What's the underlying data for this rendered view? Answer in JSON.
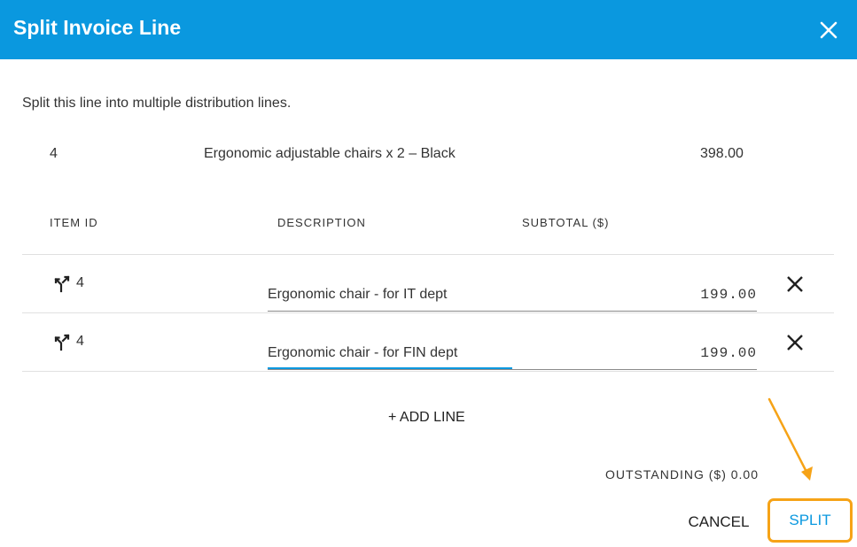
{
  "dialog": {
    "title": "Split Invoice Line",
    "intro": "Split this line into multiple distribution lines."
  },
  "original_line": {
    "item_id": "4",
    "description": "Ergonomic adjustable chairs x 2 – Black",
    "amount": "398.00"
  },
  "columns": {
    "item_id": "ITEM ID",
    "description": "DESCRIPTION",
    "subtotal": "SUBTOTAL ($)"
  },
  "lines": [
    {
      "item_id": "4",
      "description": "Ergonomic chair - for IT dept",
      "subtotal": "199.00"
    },
    {
      "item_id": "4",
      "description": "Ergonomic chair - for FIN dept",
      "subtotal": "199.00"
    }
  ],
  "add_line_label": "+ ADD LINE",
  "outstanding": "OUTSTANDING ($) 0.00",
  "buttons": {
    "cancel": "CANCEL",
    "split": "SPLIT"
  },
  "icons": {
    "close": "close-icon",
    "split_line": "split-icon",
    "remove": "remove-icon"
  },
  "colors": {
    "header": "#0a98df",
    "accent": "#0a98df",
    "highlight": "#f6a317"
  }
}
